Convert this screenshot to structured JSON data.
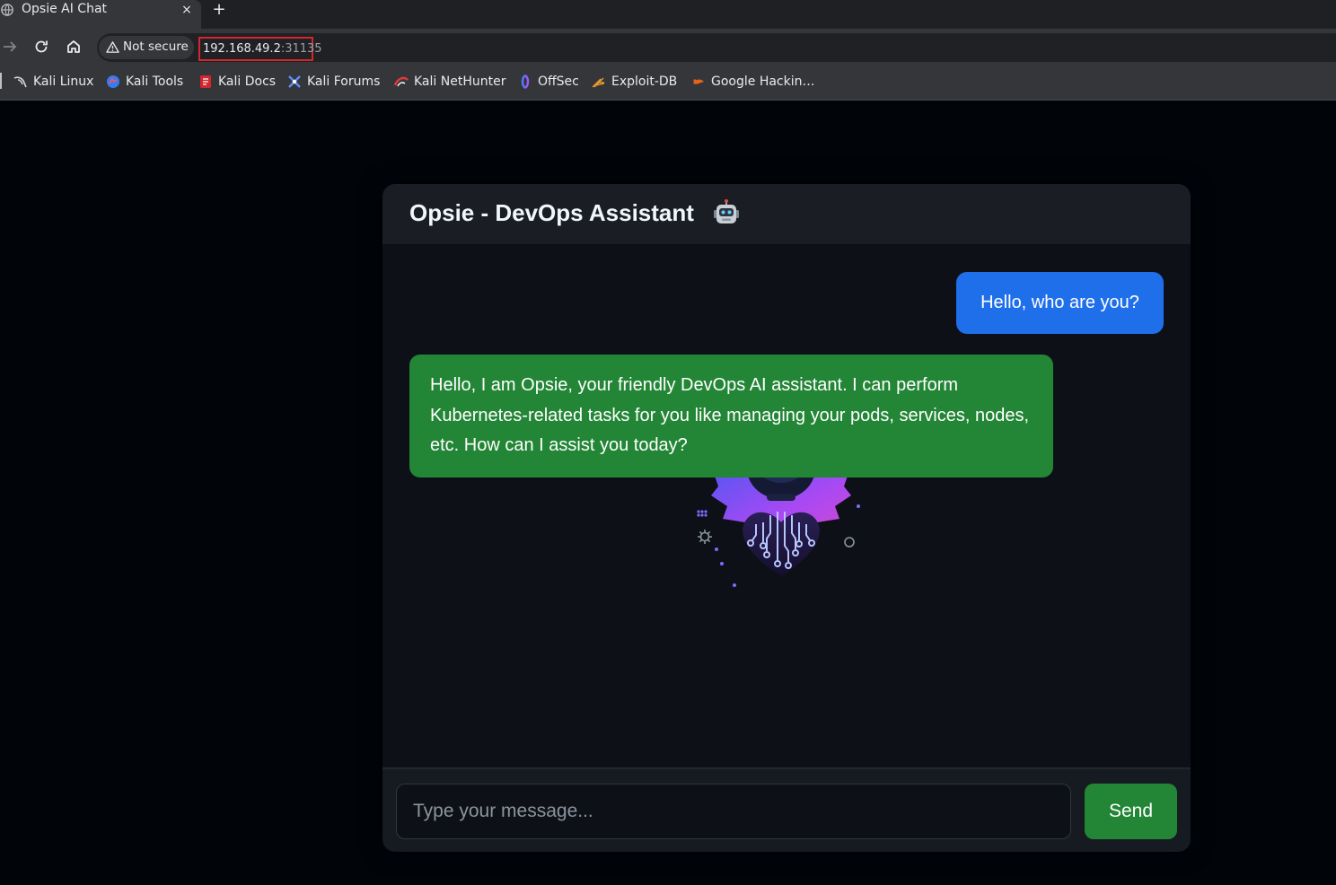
{
  "browser": {
    "tab_title": "Opsie AI Chat",
    "tab_close": "×",
    "new_tab": "+",
    "security_label": "Not secure",
    "url_host": "192.168.49.2",
    "url_port": ":31135",
    "bookmarks": [
      {
        "label": "Kali Linux",
        "icon": "kali-dragon-icon"
      },
      {
        "label": "Kali Tools",
        "icon": "kali-tools-icon"
      },
      {
        "label": "Kali Docs",
        "icon": "kali-docs-icon"
      },
      {
        "label": "Kali Forums",
        "icon": "kali-forums-icon"
      },
      {
        "label": "Kali NetHunter",
        "icon": "nethunter-icon"
      },
      {
        "label": "OffSec",
        "icon": "offsec-icon"
      },
      {
        "label": "Exploit-DB",
        "icon": "exploit-db-icon"
      },
      {
        "label": "Google Hackin…",
        "icon": "ghdb-icon"
      }
    ]
  },
  "chat": {
    "title": "Opsie - DevOps Assistant",
    "title_icon": "robot-emoji-icon",
    "messages": [
      {
        "role": "user",
        "text": "Hello, who are you?"
      },
      {
        "role": "assistant",
        "text": "Hello, I am Opsie, your friendly DevOps AI assistant. I can perform Kubernetes-related tasks for you like managing your pods, services, nodes, etc. How can I assist you today?"
      }
    ],
    "input": {
      "placeholder": "Type your message...",
      "value": ""
    },
    "send_label": "Send"
  },
  "colors": {
    "page_background": "#010409",
    "panel_background": "#0d1117",
    "header_background": "#1a1d23",
    "user_bubble": "#1f6feb",
    "assistant_bubble": "#238636",
    "send_button": "#238636",
    "url_highlight_border": "#d3262d"
  }
}
